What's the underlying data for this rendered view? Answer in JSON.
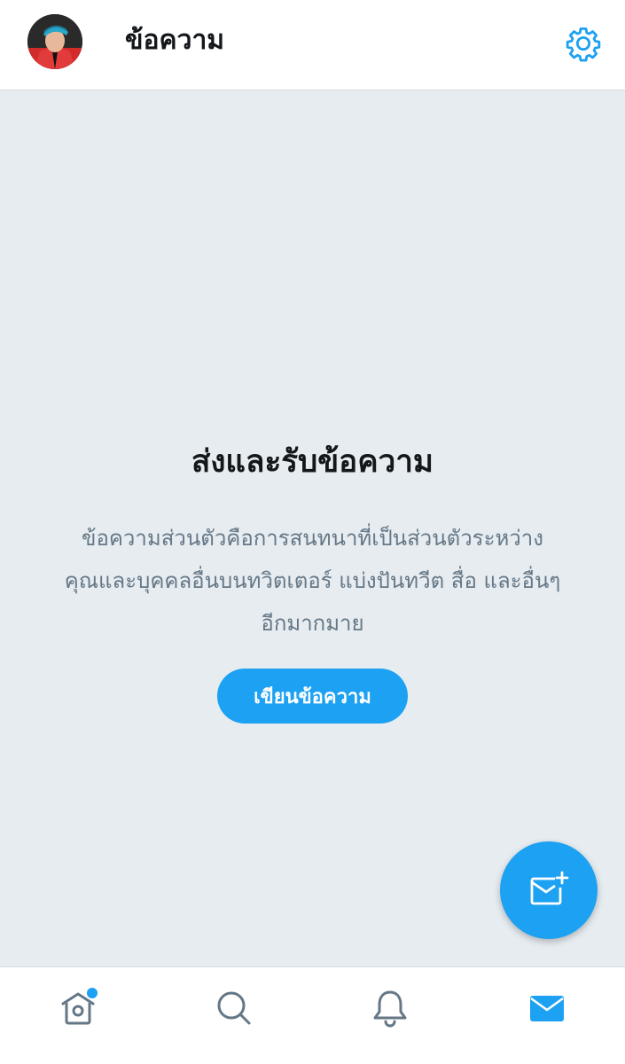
{
  "header": {
    "title": "ข้อความ",
    "avatar_icon": "profile-photo",
    "settings_icon": "gear-icon"
  },
  "empty_state": {
    "title": "ส่งและรับข้อความ",
    "description_lines": [
      "ข้อความส่วนตัวคือการสนทนาที่เป็นส่วนตัวระหว่าง",
      "คุณและบุคคลอื่นบนทวิตเตอร์ แบ่งปันทวีต สื่อ และอื่นๆ",
      "อีกมากมาย"
    ],
    "button_label": "เขียนข้อความ"
  },
  "fab": {
    "icon": "new-message-icon"
  },
  "bottom_nav": {
    "items": [
      {
        "name": "home",
        "icon": "home-icon",
        "has_badge": true
      },
      {
        "name": "search",
        "icon": "search-icon",
        "has_badge": false
      },
      {
        "name": "notifications",
        "icon": "bell-icon",
        "has_badge": false
      },
      {
        "name": "messages",
        "icon": "envelope-icon",
        "active": true
      }
    ]
  },
  "colors": {
    "accent": "#1da1f2",
    "background": "#e6ecf0",
    "text_primary": "#14171a",
    "text_secondary": "#657786",
    "icon_inactive": "#657786"
  }
}
